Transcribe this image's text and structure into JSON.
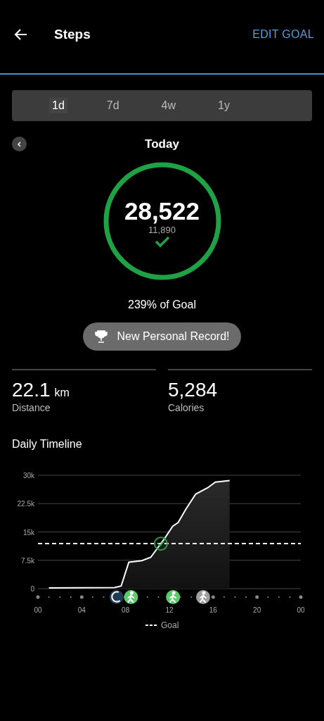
{
  "header": {
    "title": "Steps",
    "action": "EDIT GOAL"
  },
  "tabs": [
    {
      "label": "1d",
      "selected": true
    },
    {
      "label": "7d",
      "selected": false
    },
    {
      "label": "4w",
      "selected": false
    },
    {
      "label": "1y",
      "selected": false
    }
  ],
  "period": {
    "label": "Today"
  },
  "ring": {
    "steps": "28,522",
    "goal": "11,890",
    "goal_met": true,
    "level": 1
  },
  "percent": "239% of Goal",
  "badge": {
    "label": "New Personal Record!"
  },
  "stats": [
    {
      "value": "22.1",
      "unit": "km",
      "label": "Distance"
    },
    {
      "value": "5,284",
      "label": "Calories"
    }
  ],
  "timeline": {
    "title": "Daily Timeline",
    "chart_data": {
      "type": "area",
      "x": [
        0,
        1,
        7,
        7.6,
        8.3,
        9.5,
        10.3,
        11.5,
        12.3,
        12.8,
        13.5,
        14.4,
        15.5,
        16.2,
        17.5,
        24
      ],
      "series": [
        {
          "color": "#ffffff",
          "values": [
            null,
            200,
            300,
            700,
            7000,
            7400,
            8300,
            13000,
            16500,
            17500,
            21000,
            25000,
            26700,
            28200,
            28600,
            null
          ]
        },
        {
          "name": "Goal",
          "color": "#ffffff",
          "type": "line",
          "line_style": "dashed",
          "values": [
            11900,
            11900,
            11900,
            11900,
            11900,
            11900,
            11900,
            11900,
            11900,
            11900,
            11900,
            11900,
            11900,
            11900,
            11900,
            11900
          ]
        }
      ],
      "xlim": [
        0,
        24
      ],
      "ylim": [
        0,
        30000
      ],
      "xticks": [
        {
          "value": 0,
          "label": "00"
        },
        {
          "value": 4,
          "label": "04"
        },
        {
          "value": 8,
          "label": "08"
        },
        {
          "value": 12,
          "label": "12"
        },
        {
          "value": 16,
          "label": "16"
        },
        {
          "value": 20,
          "label": "20"
        },
        {
          "value": 24,
          "label": "00"
        }
      ],
      "yticks": [
        {
          "value": 0,
          "label": "0"
        },
        {
          "value": 7500,
          "label": "7.5k"
        },
        {
          "value": 15000,
          "label": "15k"
        },
        {
          "value": 22500,
          "label": "22.5k"
        },
        {
          "value": 30000,
          "label": "30k"
        }
      ],
      "grid": true
    },
    "activities": [
      {
        "kind": "sleep",
        "color": "#1e3a56"
      },
      {
        "kind": "run",
        "color": "#5cc96a"
      },
      {
        "kind": "walk",
        "color": "#5cc96a"
      },
      {
        "kind": "walk",
        "color": "#9e9e9e"
      }
    ]
  }
}
